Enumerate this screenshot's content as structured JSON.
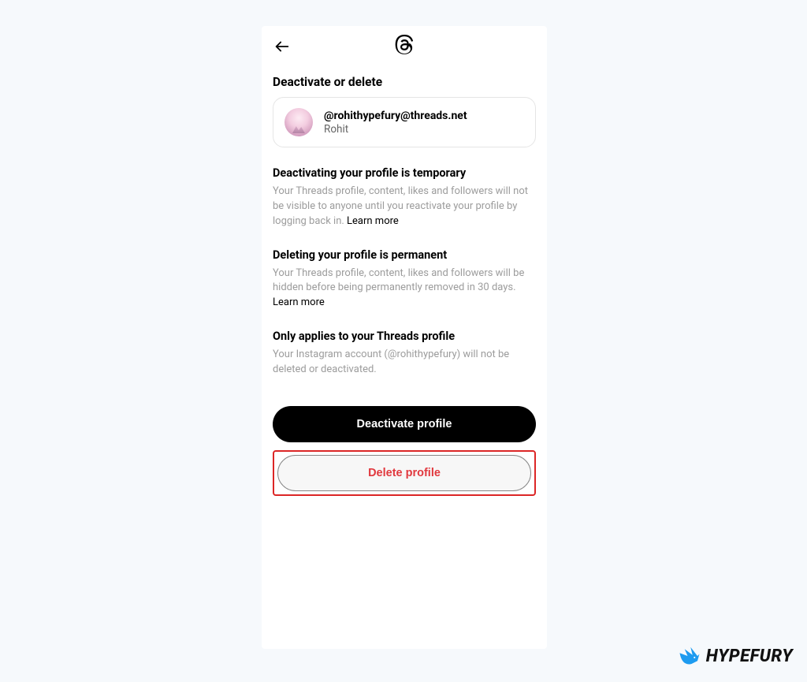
{
  "pageTitle": "Deactivate or delete",
  "profile": {
    "handle": "@rohithypefury@threads.net",
    "displayName": "Rohit"
  },
  "sections": {
    "deactivate": {
      "heading": "Deactivating your profile is temporary",
      "body": "Your Threads profile, content, likes and followers will not be visible to anyone until you reactivate your profile by logging back in.",
      "learn": "Learn more"
    },
    "delete": {
      "heading": "Deleting your profile is permanent",
      "body": "Your Threads profile, content, likes and followers will be hidden before being permanently removed in 30 days.",
      "learn": "Learn more"
    },
    "applies": {
      "heading": "Only applies to your Threads profile",
      "body": "Your Instagram account (@rohithypefury) will not be deleted or deactivated."
    }
  },
  "buttons": {
    "deactivate": "Deactivate profile",
    "delete": "Delete profile"
  },
  "watermark": "HYPEFURY"
}
